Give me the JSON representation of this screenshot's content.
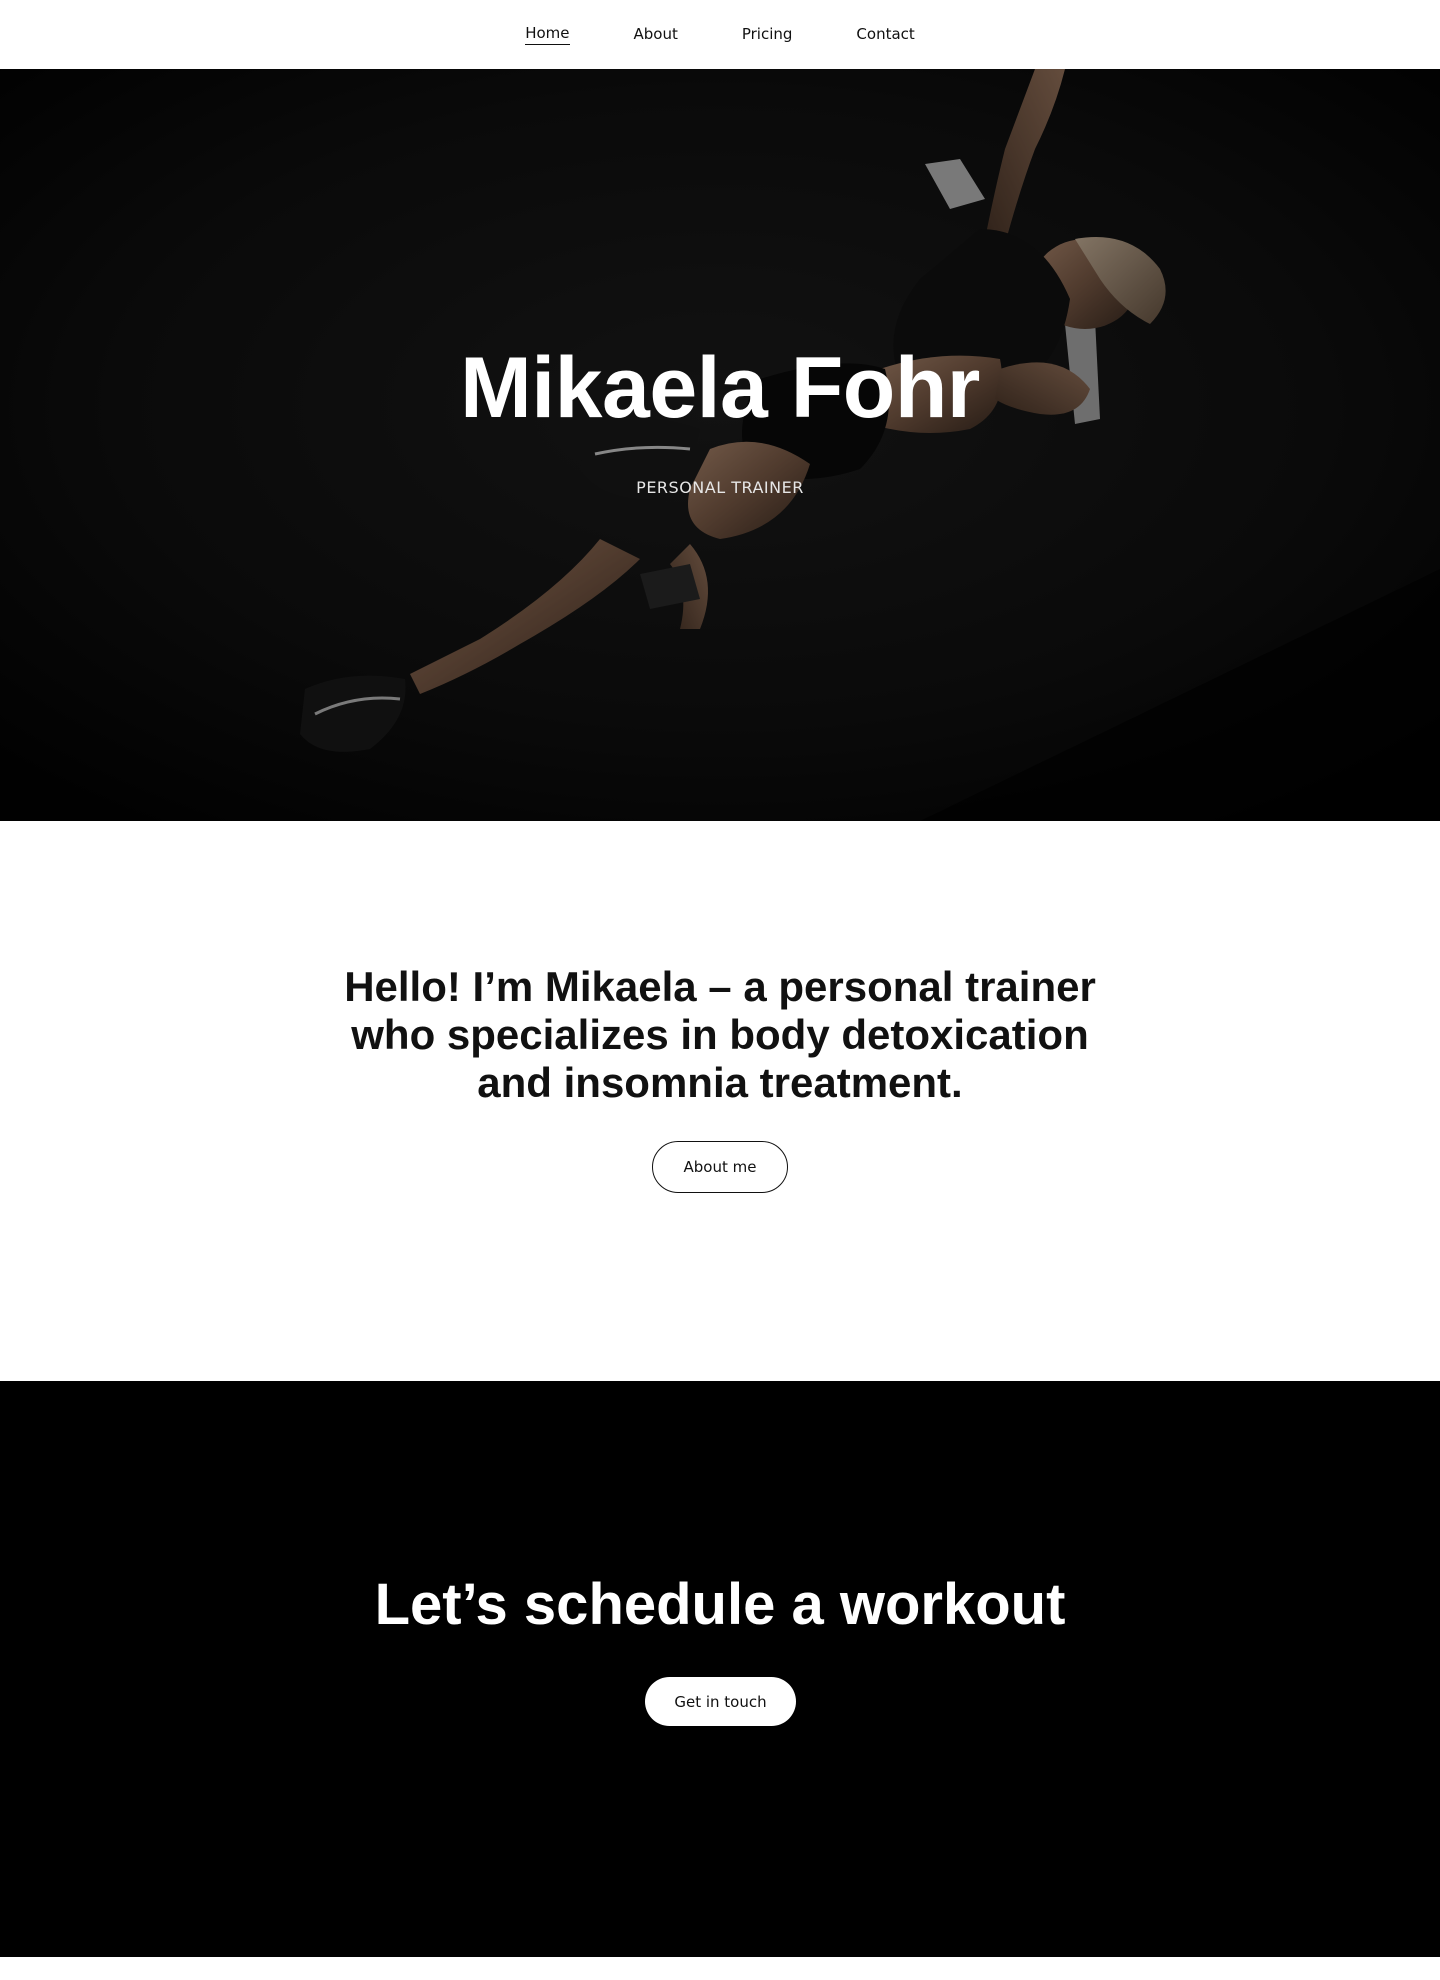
{
  "nav": {
    "items": [
      {
        "label": "Home",
        "active": true
      },
      {
        "label": "About",
        "active": false
      },
      {
        "label": "Pricing",
        "active": false
      },
      {
        "label": "Contact",
        "active": false
      }
    ]
  },
  "hero": {
    "title": "Mikaela Fohr",
    "subtitle": "PERSONAL TRAINER",
    "image_alt": "woman-doing-situps-photo"
  },
  "intro": {
    "heading": "Hello! I’m Mikaela – a personal trainer who specializes in body detoxication and insomnia treatment.",
    "button_label": "About me"
  },
  "cta": {
    "heading": "Let’s schedule a workout",
    "button_label": "Get in touch"
  },
  "colors": {
    "background": "#ffffff",
    "hero_background": "#0b0b0b",
    "cta_background": "#000000",
    "text_dark": "#111111",
    "text_light": "#ffffff"
  }
}
